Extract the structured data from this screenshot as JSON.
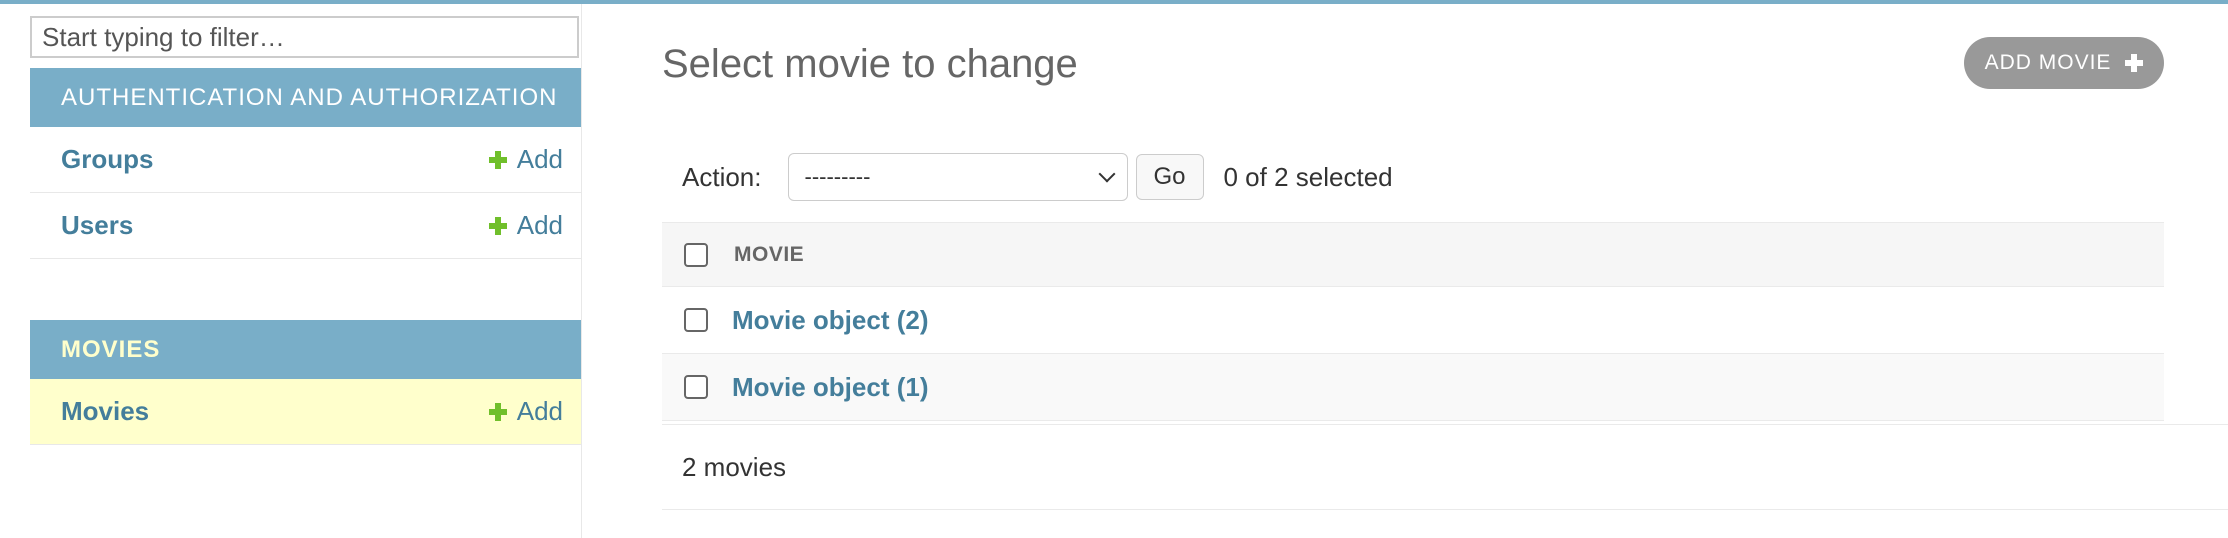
{
  "sidebar": {
    "filter_placeholder": "Start typing to filter…",
    "modules": [
      {
        "caption": "Authentication and Authorization",
        "current": false,
        "models": [
          {
            "name": "Groups",
            "add_label": "Add"
          },
          {
            "name": "Users",
            "add_label": "Add"
          }
        ]
      },
      {
        "caption": "Movies",
        "current": true,
        "models": [
          {
            "name": "Movies",
            "add_label": "Add"
          }
        ]
      }
    ]
  },
  "main": {
    "title": "Select movie to change",
    "add_button_label": "Add movie",
    "actions": {
      "label": "Action:",
      "selected_option": "---------",
      "go_label": "Go",
      "selection_count": "0 of 2 selected"
    },
    "table": {
      "column_header": "Movie",
      "rows": [
        "Movie object (2)",
        "Movie object (1)"
      ]
    },
    "paginator_text": "2 movies"
  },
  "colors": {
    "accent": "#79aec8",
    "link": "#447e9b",
    "add_icon": "#70bf2b",
    "current_row": "#ffffcc",
    "button_gray": "#999999"
  }
}
